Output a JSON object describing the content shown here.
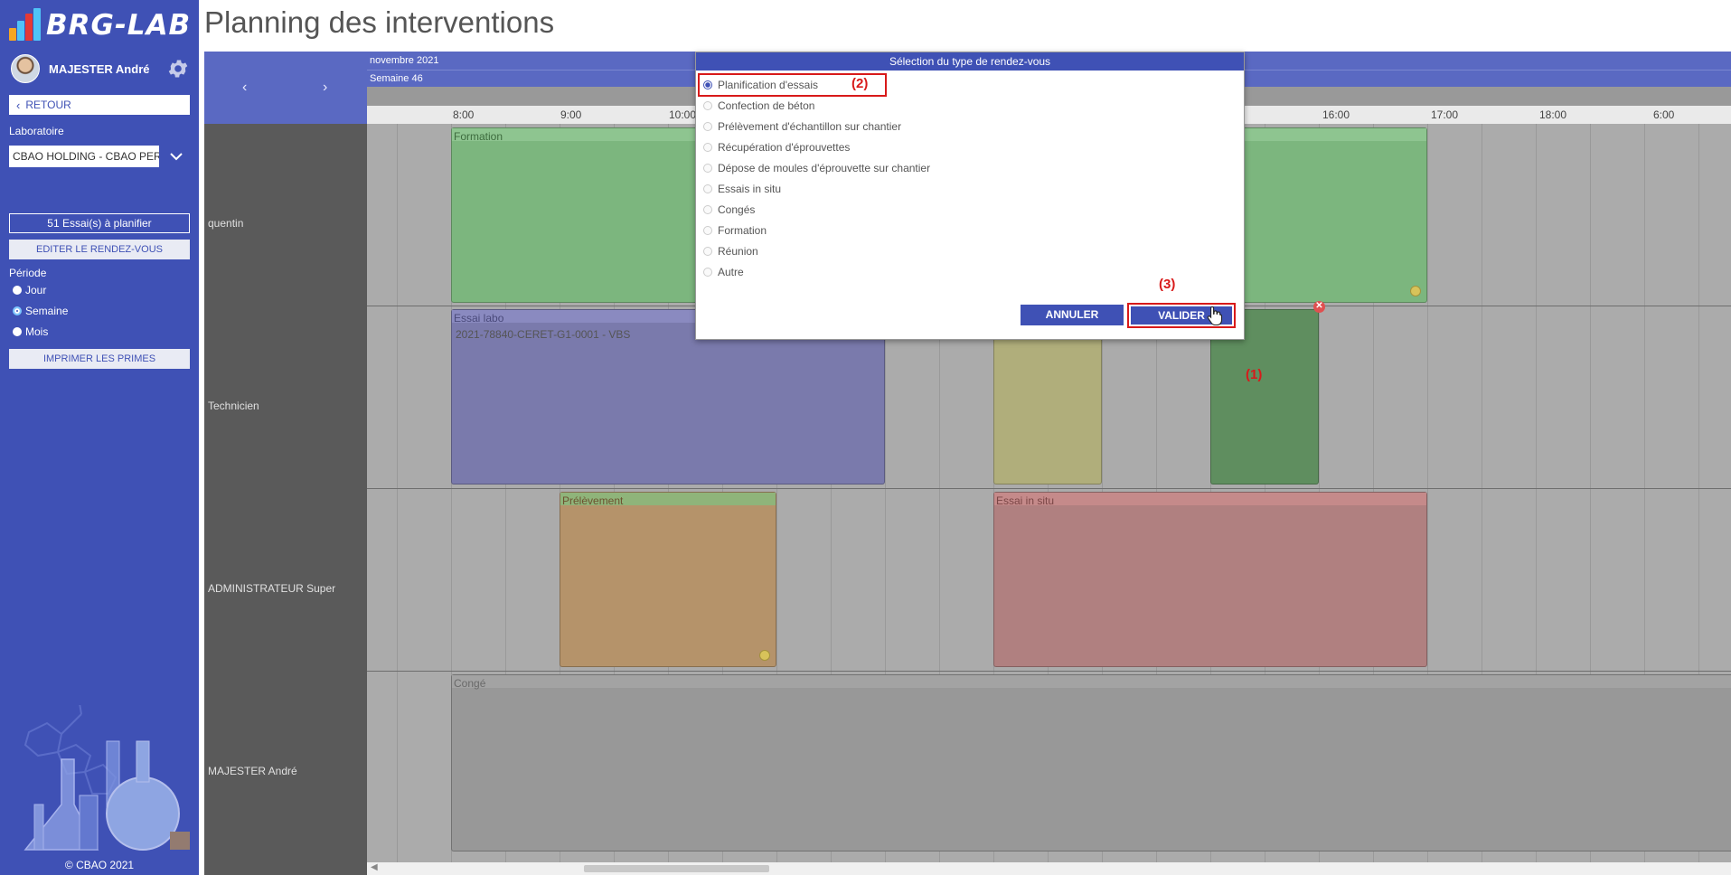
{
  "app": {
    "logo_text": "BRG-LAB",
    "page_title": "Planning des interventions",
    "copyright": "© CBAO 2021"
  },
  "sidebar": {
    "user_name": "MAJESTER André",
    "back_label": "RETOUR",
    "lab_label": "Laboratoire",
    "lab_value": "CBAO HOLDING - CBAO PERPIGNAN",
    "essais_button": "51 Essai(s) à planifier",
    "edit_button": "EDITER LE RENDEZ-VOUS",
    "period_label": "Période",
    "periods": [
      {
        "label": "Jour",
        "selected": false
      },
      {
        "label": "Semaine",
        "selected": true
      },
      {
        "label": "Mois",
        "selected": false
      }
    ],
    "print_button": "IMPRIMER LES PRIMES",
    "colors": {
      "background": "#3f51b5",
      "accent": "#7ec8ff"
    }
  },
  "calendar": {
    "month": "novembre 2021",
    "week": "Semaine 46",
    "nav_prev": "‹",
    "nav_next": "›",
    "hours": [
      "8:00",
      "9:00",
      "10:00",
      "16:00",
      "17:00",
      "18:00",
      "6:00"
    ],
    "resources": [
      "quentin",
      "Technicien",
      "ADMINISTRATEUR Super",
      "MAJESTER André"
    ],
    "events": [
      {
        "title": "Formation",
        "sub": "",
        "color": "#7cb67e"
      },
      {
        "title": "Essai labo",
        "sub": "2021-78840-CERET-G1-0001 - VBS",
        "color": "#7a7aac"
      },
      {
        "title": "",
        "sub": "",
        "color": "#b0ae7b"
      },
      {
        "title": "",
        "sub": "",
        "color": "#5f8e5f"
      },
      {
        "title": "Prélèvement",
        "sub": "",
        "color": "#b5936a"
      },
      {
        "title": "Essai in situ",
        "sub": "",
        "color": "#b08080"
      },
      {
        "title": "Congé",
        "sub": "",
        "color": "#989898"
      }
    ]
  },
  "modal": {
    "title": "Sélection du type de rendez-vous",
    "options": [
      {
        "label": "Planification d'essais",
        "selected": true
      },
      {
        "label": "Confection de béton",
        "selected": false
      },
      {
        "label": "Prélèvement d'échantillon sur chantier",
        "selected": false
      },
      {
        "label": "Récupération d'éprouvettes",
        "selected": false
      },
      {
        "label": "Dépose de moules d'éprouvette sur chantier",
        "selected": false
      },
      {
        "label": "Essais in situ",
        "selected": false
      },
      {
        "label": "Congés",
        "selected": false
      },
      {
        "label": "Formation",
        "selected": false
      },
      {
        "label": "Réunion",
        "selected": false
      },
      {
        "label": "Autre",
        "selected": false
      }
    ],
    "cancel_label": "ANNULER",
    "validate_label": "VALIDER"
  },
  "annotations": {
    "step1": "(1)",
    "step2": "(2)",
    "step3": "(3)",
    "color": "#d81a1a"
  }
}
